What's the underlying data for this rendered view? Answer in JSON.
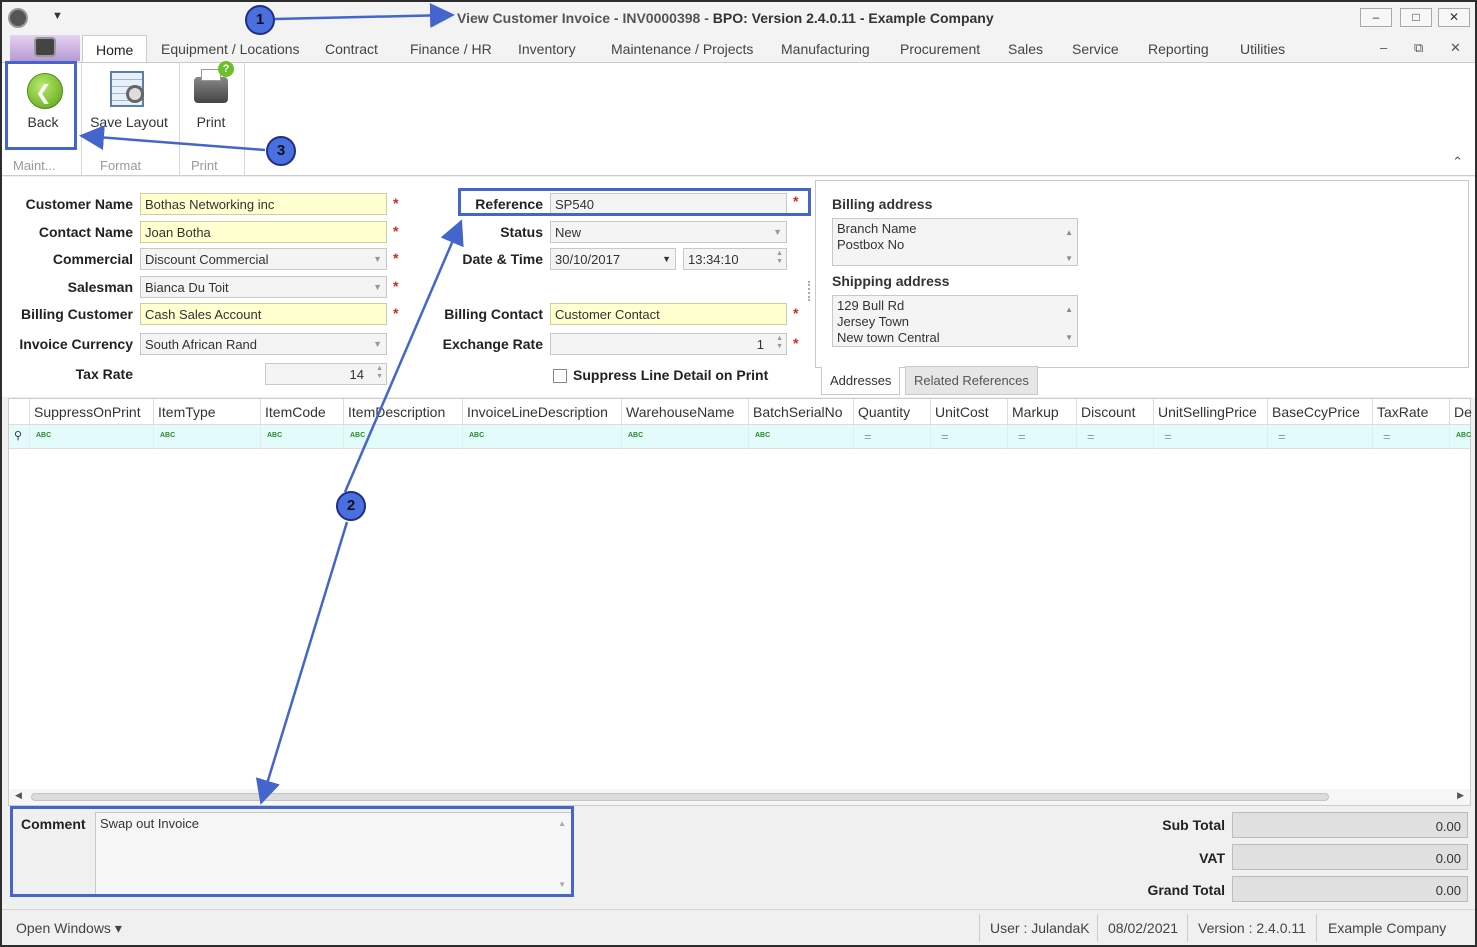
{
  "window": {
    "title": "View Customer Invoice - INV0000398 - BPO: Version 2.4.0.11 - Example Company",
    "title_part1": "View Customer Invoice - INV0000398 - ",
    "title_part2": "BPO: Version 2.4.0.11 - Example Company",
    "controls": {
      "minimize": "–",
      "maximize": "□",
      "close": "✕"
    }
  },
  "tabs": [
    "Home",
    "Equipment / Locations",
    "Contract",
    "Finance / HR",
    "Inventory",
    "Maintenance / Projects",
    "Manufacturing",
    "Procurement",
    "Sales",
    "Service",
    "Reporting",
    "Utilities"
  ],
  "ribbon": {
    "back_label": "Back",
    "save_layout_label": "Save Layout",
    "print_label": "Print",
    "groups": [
      "Maint...",
      "Format",
      "Print"
    ]
  },
  "form": {
    "customer_name": {
      "label": "Customer Name",
      "value": "Bothas Networking inc"
    },
    "contact_name": {
      "label": "Contact Name",
      "value": "Joan Botha"
    },
    "commercial": {
      "label": "Commercial",
      "value": "Discount Commercial"
    },
    "salesman": {
      "label": "Salesman",
      "value": "Bianca Du Toit"
    },
    "billing_customer": {
      "label": "Billing Customer",
      "value": "Cash Sales Account"
    },
    "invoice_currency": {
      "label": "Invoice Currency",
      "value": "South African Rand"
    },
    "tax_rate": {
      "label": "Tax Rate",
      "value": "14"
    },
    "reference": {
      "label": "Reference",
      "value": "SP540"
    },
    "status": {
      "label": "Status",
      "value": "New"
    },
    "date_time": {
      "label": "Date & Time",
      "date": "30/10/2017",
      "time": "13:34:10"
    },
    "billing_contact": {
      "label": "Billing Contact",
      "value": "Customer Contact"
    },
    "exchange_rate": {
      "label": "Exchange Rate",
      "value": "1"
    },
    "suppress_line_detail": {
      "label": "Suppress Line Detail on Print",
      "checked": false
    },
    "required_mark": "*"
  },
  "addresses": {
    "billing_title": "Billing address",
    "billing_lines": [
      "Branch Name",
      "Postbox No"
    ],
    "shipping_title": "Shipping address",
    "shipping_lines": [
      "129 Bull Rd",
      "Jersey Town",
      "New town Central"
    ],
    "tabs": [
      "Addresses",
      "Related References"
    ]
  },
  "grid": {
    "columns": [
      "SuppressOnPrint",
      "ItemType",
      "ItemCode",
      "ItemDescription",
      "InvoiceLineDescription",
      "WarehouseName",
      "BatchSerialNo",
      "Quantity",
      "UnitCost",
      "Markup",
      "Discount",
      "UnitSellingPrice",
      "BaseCcyPrice",
      "TaxRate",
      "Dep"
    ],
    "filter_text_marker": "ABC",
    "filter_num_marker": "="
  },
  "comment": {
    "label": "Comment",
    "value": "Swap out Invoice"
  },
  "totals": {
    "sub_total": {
      "label": "Sub Total",
      "value": "0.00"
    },
    "vat": {
      "label": "VAT",
      "value": "0.00"
    },
    "grand_total": {
      "label": "Grand Total",
      "value": "0.00"
    }
  },
  "status_bar": {
    "open_windows": "Open Windows ▾",
    "user": "User : JulandaK",
    "date": "08/02/2021",
    "version": "Version : 2.4.0.11",
    "company": "Example Company"
  },
  "annotations": {
    "badge1": "1",
    "badge2": "2",
    "badge3": "3"
  },
  "colors": {
    "required_bg": "#ffffd0",
    "filter_row": "#e4fbfb",
    "annotation": "#4466cc"
  }
}
